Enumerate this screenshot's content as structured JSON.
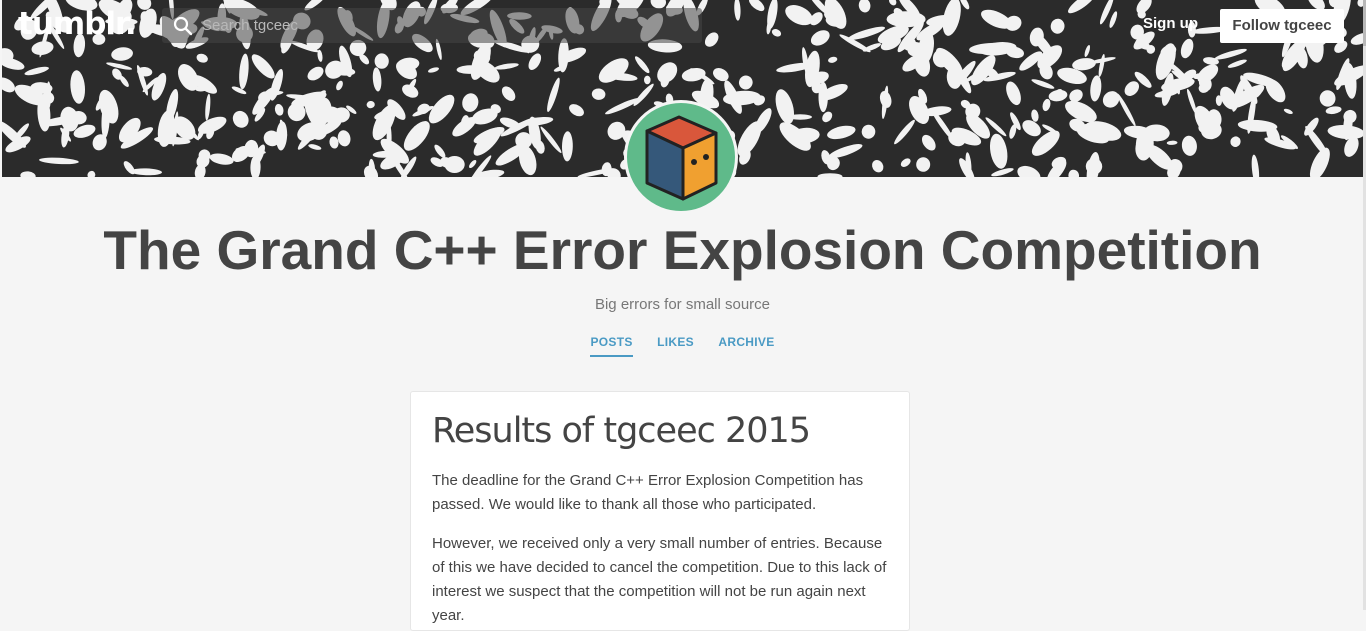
{
  "header": {
    "logo_text": "tumblr.",
    "search_placeholder": "Search tgceec",
    "signup_label": "Sign up",
    "follow_label": "Follow tgceec"
  },
  "blog": {
    "title": "The Grand C++ Error Explosion Competition",
    "description": "Big errors for small source",
    "nav": [
      "POSTS",
      "LIKES",
      "ARCHIVE"
    ],
    "active_nav": "POSTS"
  },
  "post": {
    "title": "Results of tgceec 2015",
    "paragraphs": [
      "The deadline for the Grand C++ Error Explosion Competition has passed. We would like to thank all those who participated.",
      "However, we received only a very small number of entries. Because of this we have decided to cancel the competition. Due to this lack of interest we suspect that the competition will not be run again next year."
    ]
  },
  "colors": {
    "accent": "#4a9ac4",
    "avatar_bg": "#5fba8a",
    "cube_top": "#d9573b",
    "cube_left": "#35587a",
    "cube_right": "#f0a030"
  }
}
